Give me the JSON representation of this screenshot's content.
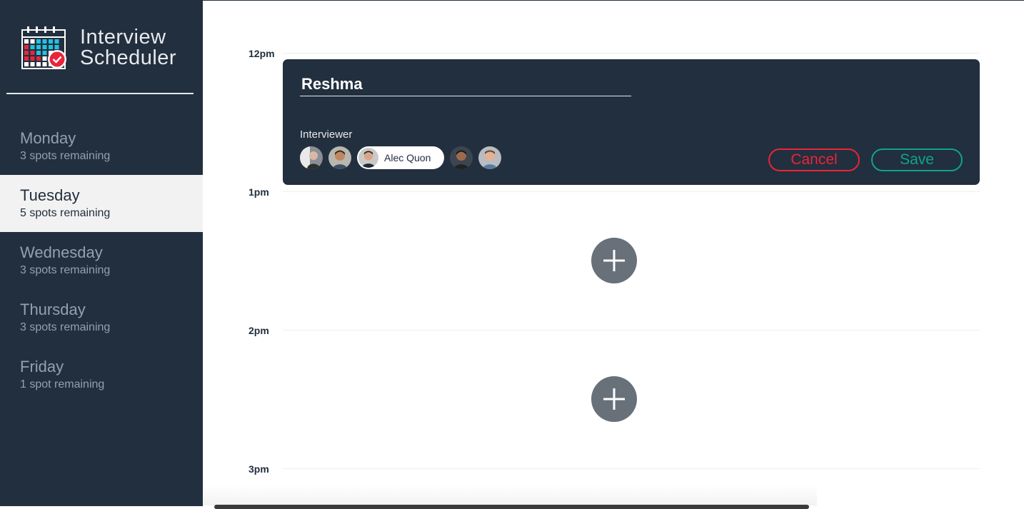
{
  "app": {
    "title_line1": "Interview",
    "title_line2": "Scheduler",
    "logo_icon": "calendar-check-icon"
  },
  "sidebar": {
    "days": [
      {
        "name": "Monday",
        "spots": "3 spots remaining",
        "selected": false
      },
      {
        "name": "Tuesday",
        "spots": "5 spots remaining",
        "selected": true
      },
      {
        "name": "Wednesday",
        "spots": "3 spots remaining",
        "selected": false
      },
      {
        "name": "Thursday",
        "spots": "3 spots remaining",
        "selected": false
      },
      {
        "name": "Friday",
        "spots": "1 spot remaining",
        "selected": false
      }
    ]
  },
  "schedule": {
    "slots": [
      "12pm",
      "1pm",
      "2pm",
      "3pm"
    ],
    "add_icon": "plus-icon"
  },
  "form": {
    "student_name": "Reshma",
    "interviewer_label": "Interviewer",
    "selected_interviewer": "Alec Quon",
    "cancel_label": "Cancel",
    "save_label": "Save"
  },
  "colors": {
    "sidebar": "#222f3e",
    "selected_day": "#f2f2f2",
    "cancel": "#e8253a",
    "save": "#0ea58a",
    "add_button": "#68707a"
  }
}
